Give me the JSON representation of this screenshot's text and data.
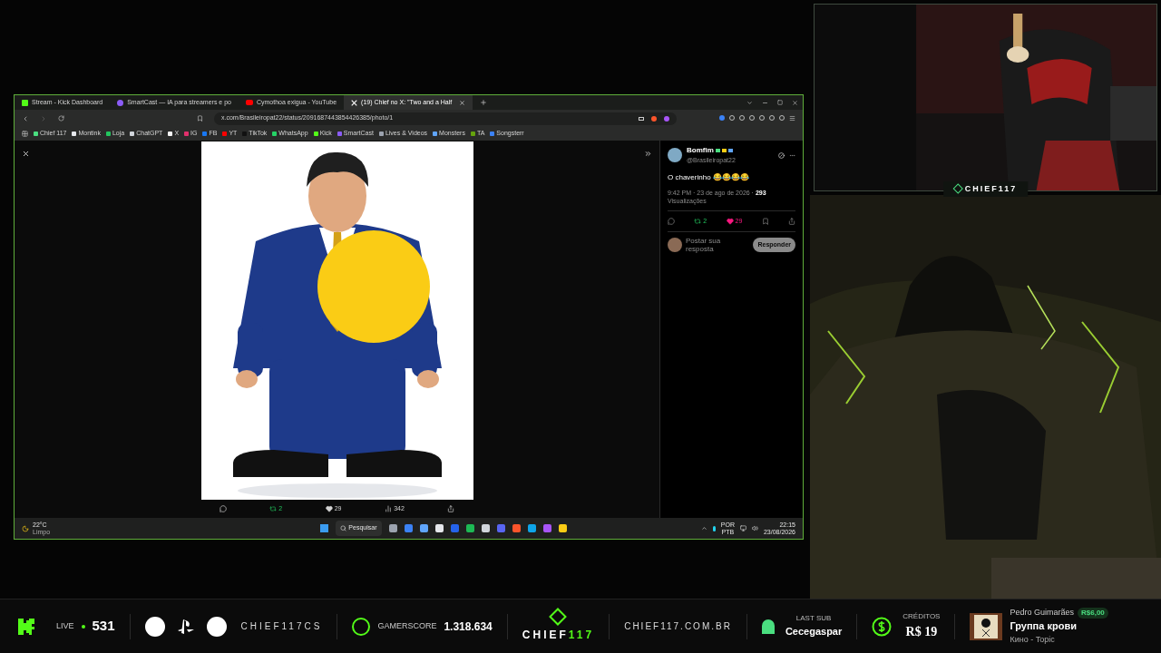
{
  "browser": {
    "tabs": [
      {
        "title": "Stream - Kick Dashboard",
        "kind": "kick",
        "selected": false
      },
      {
        "title": "SmartCast — IA para streamers e po",
        "kind": "smartcast",
        "selected": false
      },
      {
        "title": "Cymothoa exigua - YouTube",
        "kind": "youtube",
        "selected": false
      },
      {
        "title": "(19) Chief no X: \"Two and a Half",
        "kind": "x",
        "selected": true
      }
    ],
    "url": "x.com/Brasileiropat22/status/2091687443854426385/photo/1",
    "bookmarks": [
      {
        "label": "Chief 117",
        "color": "#4ade80"
      },
      {
        "label": "Montink",
        "color": "#e5e7eb"
      },
      {
        "label": "Loja",
        "color": "#22c55e"
      },
      {
        "label": "ChatGPT",
        "color": "#d1d5db"
      },
      {
        "label": "X",
        "color": "#f5f5f5"
      },
      {
        "label": "IG",
        "color": "#e1306c"
      },
      {
        "label": "FB",
        "color": "#1877f2"
      },
      {
        "label": "YT",
        "color": "#ff0000"
      },
      {
        "label": "TikTok",
        "color": "#111111"
      },
      {
        "label": "WhatsApp",
        "color": "#25d366"
      },
      {
        "label": "Kick",
        "color": "#53fc18"
      },
      {
        "label": "SmartCast",
        "color": "#8b5cf6"
      },
      {
        "label": "Lives & Videos",
        "color": "#9ca3af"
      },
      {
        "label": "Monsters",
        "color": "#60a5fa"
      },
      {
        "label": "TA",
        "color": "#65a30d"
      },
      {
        "label": "Songsterr",
        "color": "#3b82f6"
      }
    ]
  },
  "photo_actions": {
    "reposts": "2",
    "likes": "29",
    "views": "342"
  },
  "post": {
    "author": "Bomfim",
    "handle": "@Brasileiropat22",
    "text": "O chaverinho 😂😂😂😂",
    "time": "9:42 PM · 23 de ago de 2026 · ",
    "views_count": "293",
    "views_label": "Visualizações",
    "reposts": "2",
    "likes": "29",
    "liked": true,
    "reply_placeholder": "Postar sua resposta",
    "reply_button": "Responder"
  },
  "taskbar": {
    "temperature": "22°C",
    "weather": "Limpo",
    "search": "Pesquisar",
    "language": "POR",
    "layout": "PTB",
    "time": "22:15",
    "date": "23/08/2026"
  },
  "webcam": {
    "label": "CHIEF117"
  },
  "overlay": {
    "live_label": "LIVE",
    "viewers": "531",
    "handle": "CHIEF117CS",
    "gamerscore_label": "GAMERSCORE",
    "gamerscore": "1.318.634",
    "logo_name": "CHIEF",
    "logo_number": "117",
    "site": "CHIEF117.COM.BR",
    "last_sub_label": "LAST SUB",
    "last_sub": "Cecegaspar",
    "credits_label": "CRÉDITOS",
    "credits": "R$ 19",
    "music": {
      "donor": "Pedro Guimarães",
      "amount": "R$6,00",
      "song": "Группа крови",
      "artist": "Кино - Topic"
    }
  }
}
